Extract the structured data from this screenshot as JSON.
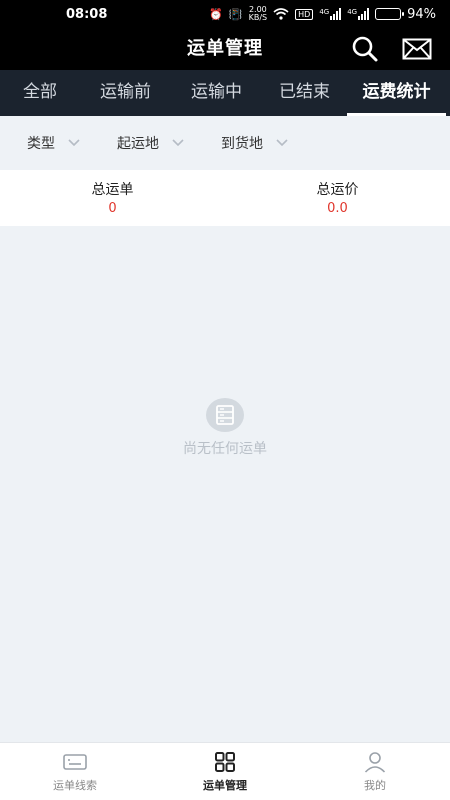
{
  "status_bar": {
    "time": "08:08",
    "net_speed_value": "2.00",
    "net_speed_unit": "KB/S",
    "hd_label": "HD",
    "signal1_label": "4G",
    "signal2_label": "4G",
    "battery_percent": 94,
    "battery_text": "94%"
  },
  "header": {
    "title": "运单管理",
    "icons": [
      "search-icon",
      "mail-icon"
    ]
  },
  "tabs": [
    {
      "label": "全部",
      "active": false
    },
    {
      "label": "运输前",
      "active": false
    },
    {
      "label": "运输中",
      "active": false
    },
    {
      "label": "已结束",
      "active": false
    },
    {
      "label": "运费统计",
      "active": true
    }
  ],
  "filters": [
    {
      "label": "类型"
    },
    {
      "label": "起运地"
    },
    {
      "label": "到货地"
    }
  ],
  "summary": {
    "total_orders_label": "总运单",
    "total_orders_value": "0",
    "total_freight_label": "总运价",
    "total_freight_value": "0.0"
  },
  "empty_state": {
    "text": "尚无任何运单",
    "icon": "empty-box-icon"
  },
  "bottom_nav": [
    {
      "label": "运单线索",
      "icon": "keyboard-icon",
      "active": false
    },
    {
      "label": "运单管理",
      "icon": "grid-icon",
      "active": true
    },
    {
      "label": "我的",
      "icon": "user-icon",
      "active": false
    }
  ],
  "colors": {
    "header_bg": "#000000",
    "tabs_bg": "#1b232e",
    "accent_red": "#e0362c",
    "page_bg": "#eef2f6"
  }
}
